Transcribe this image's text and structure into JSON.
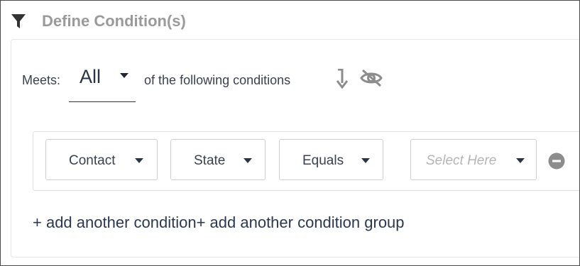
{
  "header": {
    "title": "Define Condition(s)",
    "icon": "filter-icon"
  },
  "meets": {
    "label": "Meets:",
    "selected": "All",
    "suffix": "of the following conditions"
  },
  "condition": {
    "entity": "Contact",
    "field": "State",
    "operator": "Equals",
    "value_placeholder": "Select Here"
  },
  "actions": {
    "add_condition": "+ add another condition",
    "add_group": "+ add another condition group"
  },
  "colors": {
    "title_gray": "#9a9a9a",
    "text_dark": "#3a4150",
    "placeholder": "#b5b5b5",
    "icon_gray": "#8c8c8c",
    "link_navy": "#2b3850"
  }
}
